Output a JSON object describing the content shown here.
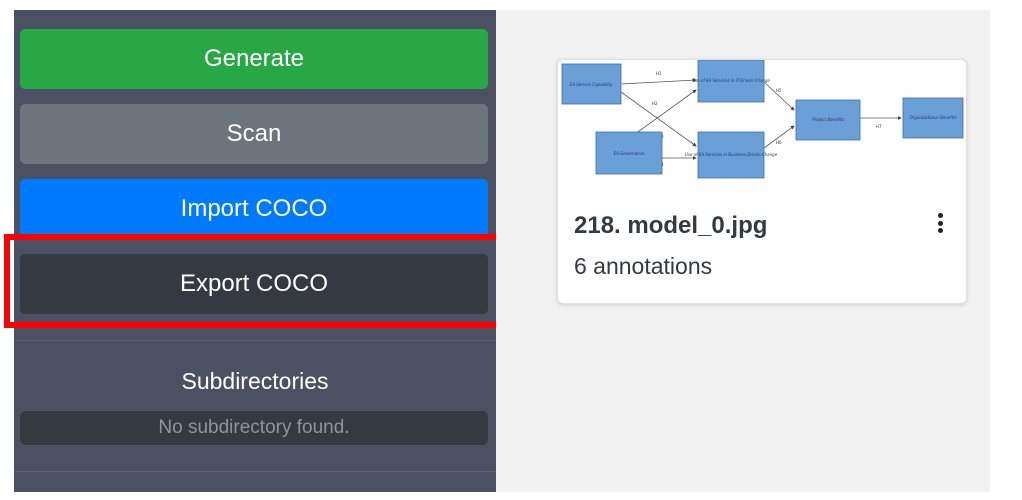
{
  "sidebar": {
    "buttons": {
      "generate": "Generate",
      "scan": "Scan",
      "import": "Import COCO",
      "export": "Export COCO"
    },
    "subdirectories": {
      "title": "Subdirectories",
      "empty_message": "No subdirectory found."
    }
  },
  "colors": {
    "generate": "#28a745",
    "scan": "#6c757d",
    "import": "#007bff",
    "export": "#343a40",
    "sidebar_bg": "#4b5162",
    "highlight": "#ff0000"
  },
  "card": {
    "title": "218. model_0.jpg",
    "subtitle": "6 annotations",
    "menu_icon": "kebab-menu-icon",
    "diagram": {
      "nodes": [
        "EA Service Capability",
        "EA Governance",
        "Use of EA Services in IT-Driven Change",
        "Use of EA Services in Business-Driven Change",
        "Project Benefits",
        "Organizational Benefits"
      ],
      "edges": [
        "H1",
        "H2",
        "H3",
        "H4",
        "H5",
        "H6",
        "H7"
      ]
    }
  }
}
